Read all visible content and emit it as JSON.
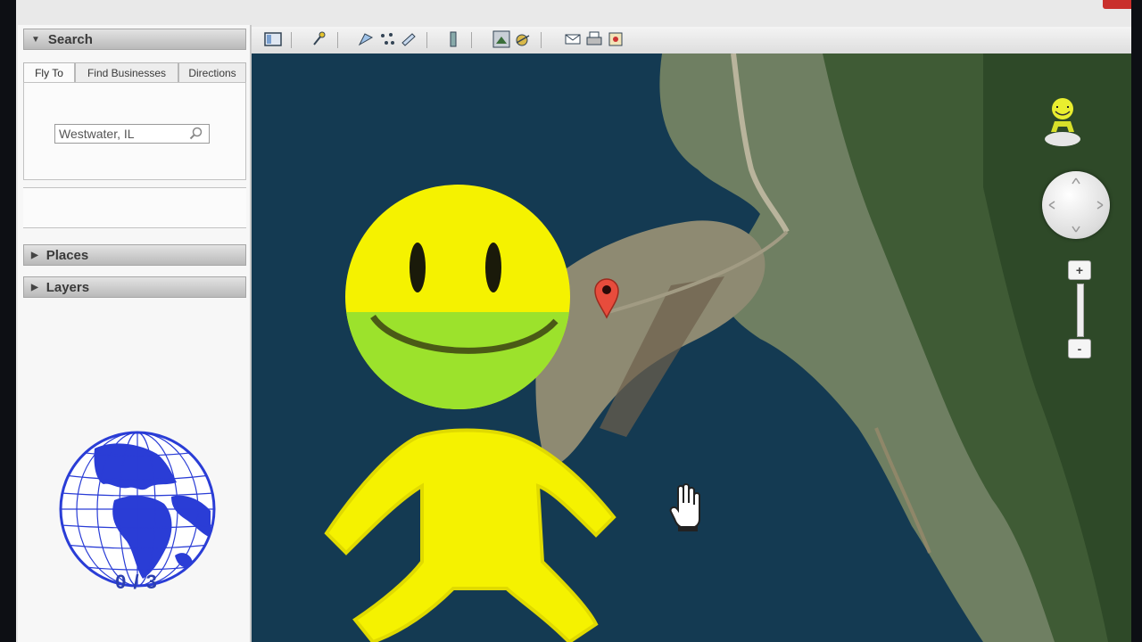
{
  "sidebar": {
    "search_header": "Search",
    "tabs": [
      "Fly To",
      "Find Businesses",
      "Directions"
    ],
    "search": {
      "value": "Westwater, IL"
    },
    "places_header": "Places",
    "layers_header": "Layers",
    "counter": "0 / 3"
  },
  "toolbar": {
    "buttons": [
      "sidebar-toggle-icon",
      "placemark-icon",
      "polygon-icon",
      "path-icon",
      "overlay-icon",
      "ruler-icon",
      "sunlight-icon",
      "sky-icon",
      "email-icon",
      "print-icon",
      "view-in-maps-icon"
    ]
  },
  "map": {
    "pegman_icon": "street-view-figure-icon",
    "marker_icon": "location-pin-icon",
    "cursor_icon": "hand-cursor-icon",
    "zoom_in": "+",
    "zoom_out": "-"
  },
  "colors": {
    "water": "#143a52",
    "land": "#7d8a70",
    "forest": "#3d5a32",
    "smiley": "#f5f200",
    "globe": "#2a3dd6",
    "marker": "#e74c3c"
  }
}
